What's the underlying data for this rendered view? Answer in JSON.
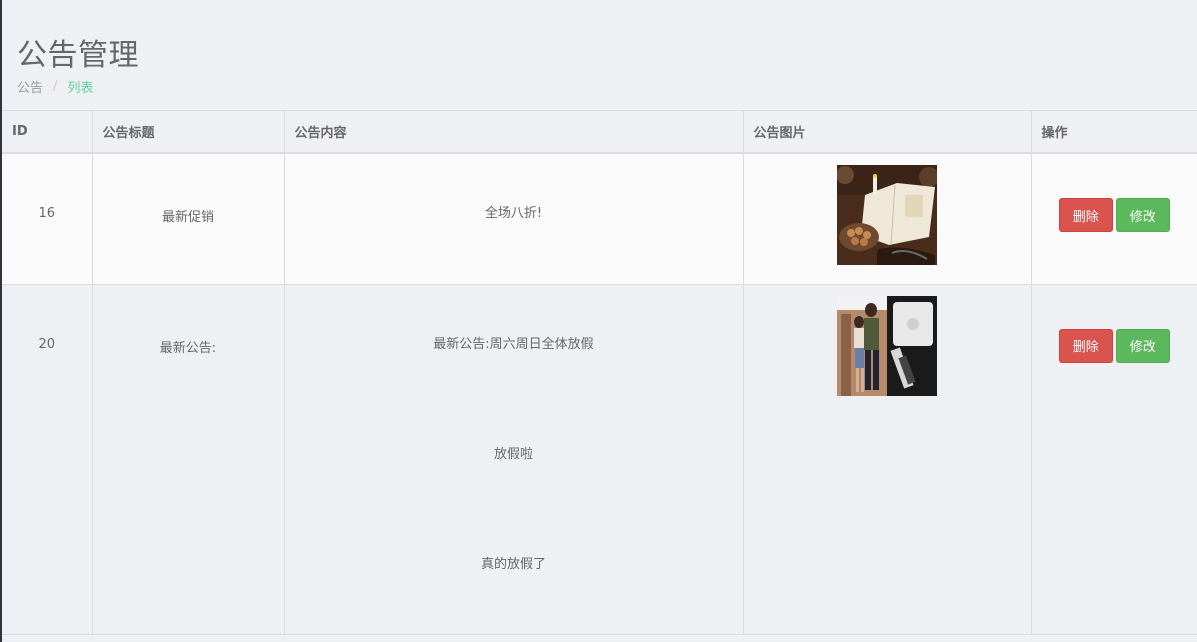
{
  "header": {
    "title": "公告管理",
    "breadcrumb": [
      "公告",
      "列表"
    ]
  },
  "table": {
    "columns": [
      "ID",
      "公告标题",
      "公告内容",
      "公告图片",
      "操作"
    ],
    "rows": [
      {
        "id": "16",
        "title": "最新促销",
        "content": [
          "全场八折!"
        ],
        "image": "book-candle-walnuts-photo",
        "actions": {
          "delete": "删除",
          "edit": "修改"
        }
      },
      {
        "id": "20",
        "title": "最新公告:",
        "content": [
          "最新公告:周六周日全体放假",
          "放假啦",
          "真的放假了"
        ],
        "image": "couple-and-phone-cable-photo",
        "actions": {
          "delete": "删除",
          "edit": "修改"
        }
      }
    ]
  },
  "colors": {
    "delete": "#d9534f",
    "edit": "#5cb85c",
    "breadcrumb_active": "#5ed0a0"
  }
}
